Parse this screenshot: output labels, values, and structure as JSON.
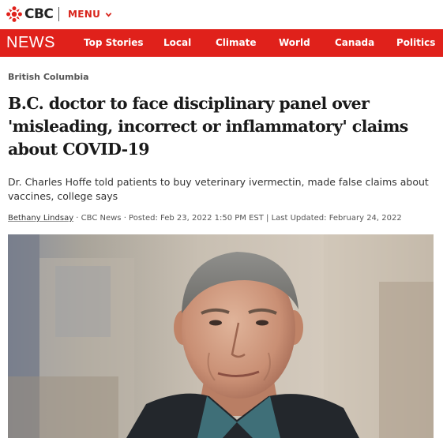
{
  "brand": {
    "logo_text": "CBC",
    "menu_label": "MENU",
    "news_wordmark": "NEWS"
  },
  "nav": {
    "items": [
      "Top Stories",
      "Local",
      "Climate",
      "World",
      "Canada",
      "Politics"
    ]
  },
  "article": {
    "section": "British Columbia",
    "headline_lines": [
      "B.C. doctor to face disciplinary panel over",
      "'misleading, incorrect or inflammatory' claims",
      "about COVID-19"
    ],
    "deck_lines": [
      "Dr. Charles Hoffe told patients to buy veterinary ivermectin, made false claims about",
      "vaccines, college says"
    ],
    "byline": {
      "author": "Bethany Lindsay",
      "rest": " · CBC News · Posted: Feb 23, 2022 1:50 PM EST | Last Updated: February 24, 2022"
    }
  },
  "colors": {
    "brand_red": "#e0211b",
    "menu_red": "#d8231a",
    "text_dark": "#1a1a1a",
    "text_muted": "#555555"
  },
  "icons": {
    "logo": "cbc-gem-icon",
    "menu": "chevron-down-icon"
  }
}
